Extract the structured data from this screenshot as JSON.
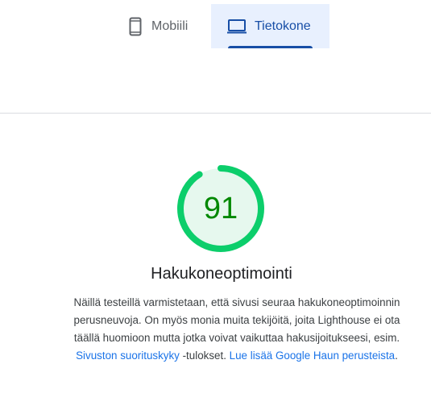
{
  "tabs": {
    "mobile_label": "Mobiili",
    "desktop_label": "Tietokone",
    "selected": "desktop"
  },
  "score": {
    "value": 91,
    "fraction": 0.91,
    "ring_color": "#0cce6b",
    "fill_color": "#e6f8ee",
    "text_color": "#008800"
  },
  "category": {
    "title": "Hakukoneoptimointi",
    "description_text": "Näillä testeillä varmistetaan, että sivusi seuraa hakukoneoptimoinnin perusneuvoja. On myös monia muita tekijöitä, joita Lighthouse ei ota täällä huomioon mutta jotka voivat vaikuttaa hakusijoitukseesi, esim. ",
    "link1_text": "Sivuston suorituskyky",
    "middle_text": " -tulokset. ",
    "link2_text": "Lue lisää Google Haun perusteista",
    "end_text": "."
  }
}
